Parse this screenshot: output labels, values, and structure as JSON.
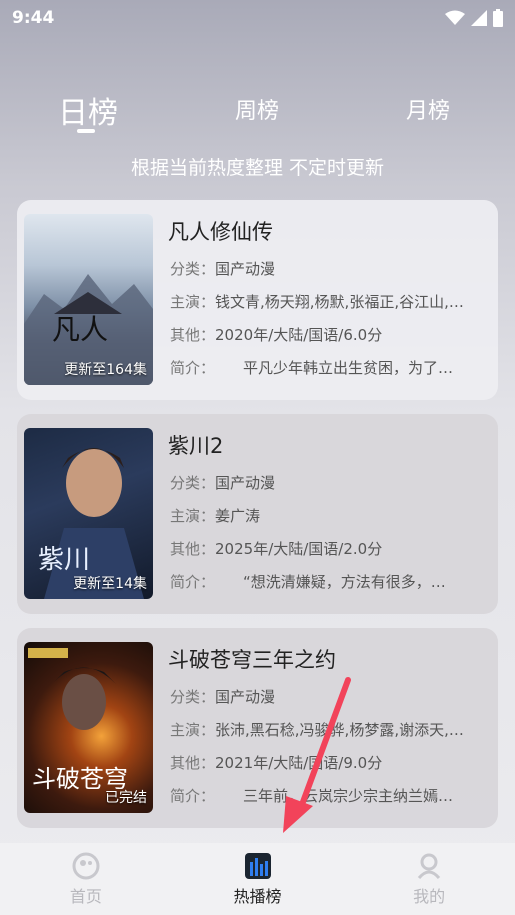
{
  "status": {
    "time": "9:44"
  },
  "tabs": [
    {
      "label": "日榜",
      "active": true
    },
    {
      "label": "周榜",
      "active": false
    },
    {
      "label": "月榜",
      "active": false
    }
  ],
  "subtitle": "根据当前热度整理 不定时更新",
  "labels": {
    "category": "分类：",
    "cast": "主演：",
    "other": "其他：",
    "brief": "简介："
  },
  "items": [
    {
      "title": "凡人修仙传",
      "poster_label": "更新至164集",
      "category": "国产动漫",
      "cast": "钱文青,杨天翔,杨默,张福正,谷江山,…",
      "other": "2020年/大陆/国语/6.0分",
      "brief": "平凡少年韩立出生贫困，为了…"
    },
    {
      "title": "紫川2",
      "poster_label": "更新至14集",
      "category": "国产动漫",
      "cast": "姜广涛",
      "other": "2025年/大陆/国语/2.0分",
      "brief": "“想洗清嫌疑，方法有很多，…"
    },
    {
      "title": "斗破苍穹三年之约",
      "poster_label": "已完结",
      "category": "国产动漫",
      "cast": "张沛,黑石稔,冯骏骅,杨梦露,谢添天,…",
      "other": "2021年/大陆/国语/9.0分",
      "brief": "三年前，云岚宗少宗主纳兰嫣…"
    }
  ],
  "nav": [
    {
      "label": "首页",
      "icon": "home-icon",
      "active": false
    },
    {
      "label": "热播榜",
      "icon": "chart-icon",
      "active": true
    },
    {
      "label": "我的",
      "icon": "profile-icon",
      "active": false
    }
  ],
  "colors": {
    "accent": "#2f7ef0",
    "arrow": "#f2435a"
  }
}
